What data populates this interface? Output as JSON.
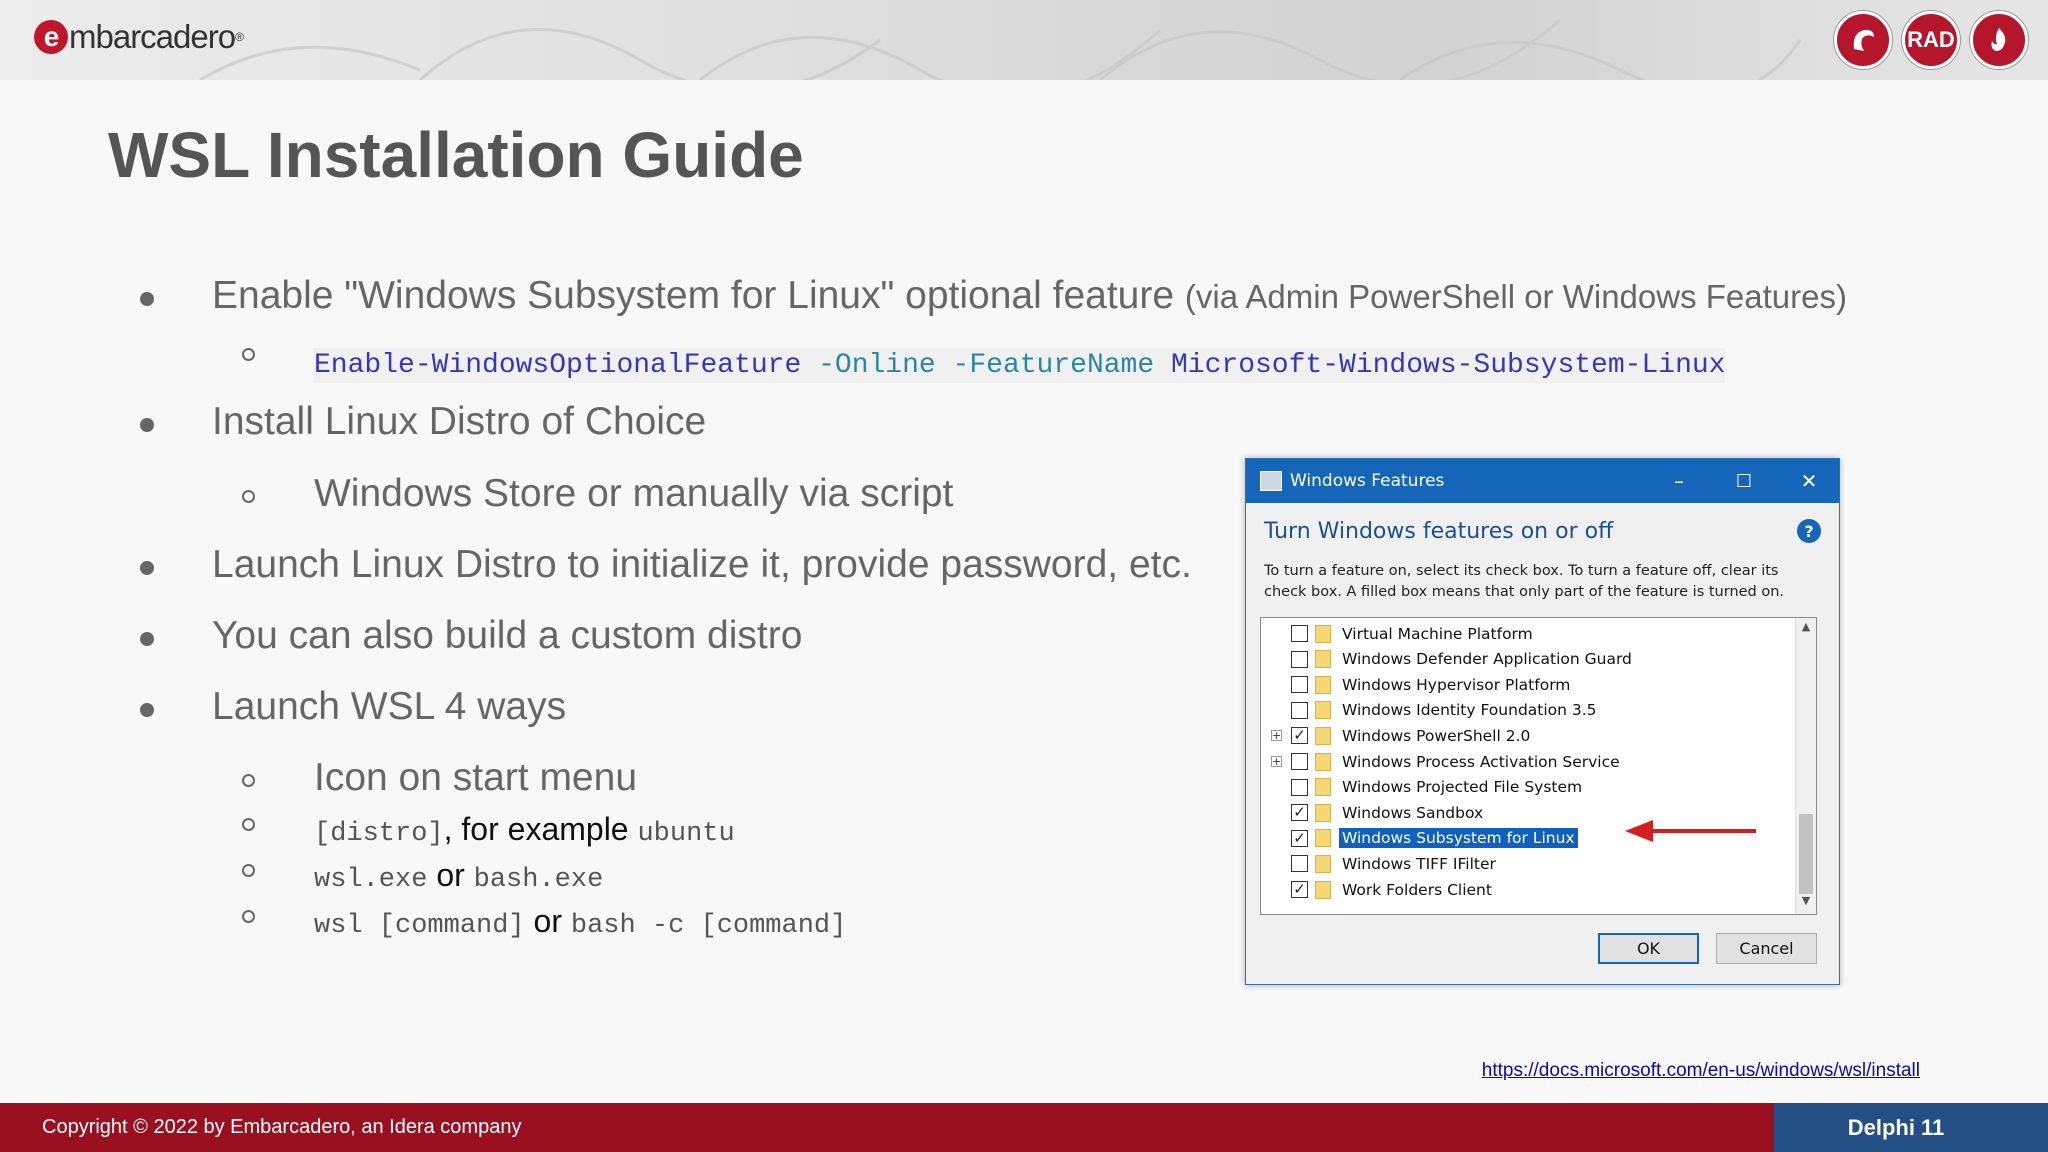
{
  "header": {
    "logo_text": "mbarcadero",
    "logo_letter": "e",
    "badges": [
      "",
      "RAD",
      ""
    ]
  },
  "title": "WSL Installation Guide",
  "bullets": {
    "b1_main": "Enable \"Windows Subsystem for Linux\" optional feature",
    "b1_note": "(via Admin PowerShell or Windows Features)",
    "b1_cmd": {
      "cmdlet": "Enable-WindowsOptionalFeature",
      "p1": "-Online",
      "p2": "-FeatureName",
      "arg": "Microsoft-Windows-Subsystem-Linux"
    },
    "b2": "Install Linux Distro of Choice",
    "b2_sub": "Windows Store or manually via script",
    "b3": "Launch Linux Distro to initialize it, provide password, etc.",
    "b4": "You can also build a custom distro",
    "b5": "Launch WSL 4 ways",
    "b5_sub1": "Icon on start menu",
    "b5_sub2_code1": "[distro]",
    "b5_sub2_text": ", for example ",
    "b5_sub2_code2": "ubuntu",
    "b5_sub3_code1": "wsl.exe",
    "b5_sub3_text": " or ",
    "b5_sub3_code2": "bash.exe",
    "b5_sub4_code1": "wsl [command]",
    "b5_sub4_text": " or ",
    "b5_sub4_code2": "bash -c [command]"
  },
  "dialog": {
    "title": "Windows Features",
    "minimize": "–",
    "maximize": "☐",
    "close": "✕",
    "heading": "Turn Windows features on or off",
    "help": "?",
    "description": "To turn a feature on, select its check box. To turn a feature off, clear its check box. A filled box means that only part of the feature is turned on.",
    "features": [
      {
        "label": "Virtual Machine Platform",
        "checked": false,
        "expandable": false,
        "selected": false
      },
      {
        "label": "Windows Defender Application Guard",
        "checked": false,
        "expandable": false,
        "selected": false
      },
      {
        "label": "Windows Hypervisor Platform",
        "checked": false,
        "expandable": false,
        "selected": false
      },
      {
        "label": "Windows Identity Foundation 3.5",
        "checked": false,
        "expandable": false,
        "selected": false
      },
      {
        "label": "Windows PowerShell 2.0",
        "checked": true,
        "expandable": true,
        "selected": false
      },
      {
        "label": "Windows Process Activation Service",
        "checked": false,
        "expandable": true,
        "selected": false
      },
      {
        "label": "Windows Projected File System",
        "checked": false,
        "expandable": false,
        "selected": false
      },
      {
        "label": "Windows Sandbox",
        "checked": true,
        "expandable": false,
        "selected": false
      },
      {
        "label": "Windows Subsystem for Linux",
        "checked": true,
        "expandable": false,
        "selected": true
      },
      {
        "label": "Windows TIFF IFilter",
        "checked": false,
        "expandable": false,
        "selected": false
      },
      {
        "label": "Work Folders Client",
        "checked": true,
        "expandable": false,
        "selected": false
      }
    ],
    "ok_label": "OK",
    "cancel_label": "Cancel"
  },
  "link": "https://docs.microsoft.com/en-us/windows/wsl/install",
  "footer": {
    "copyright": "Copyright © 2022 by Embarcadero, an Idera company",
    "product": "Delphi 11"
  },
  "colors": {
    "brand_red": "#9b1020",
    "brand_blue": "#234f85",
    "dialog_blue": "#1565b9",
    "code_blue": "#3737b8",
    "code_teal": "#2b86a6"
  }
}
